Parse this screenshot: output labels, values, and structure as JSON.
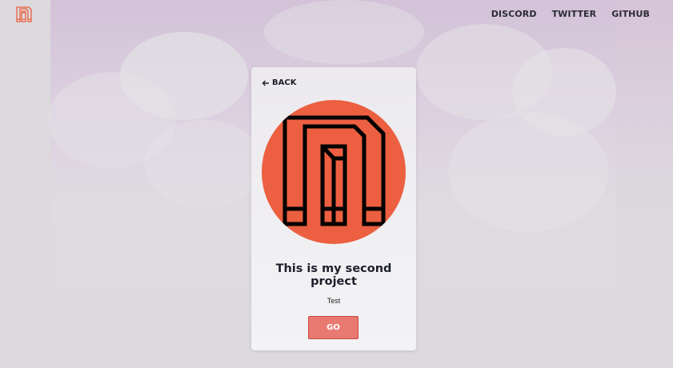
{
  "nav": {
    "links": [
      {
        "label": "DISCORD"
      },
      {
        "label": "TWITTER"
      },
      {
        "label": "GITHUB"
      }
    ]
  },
  "card": {
    "back_label": "BACK",
    "title": "This is my second project",
    "description": "Test",
    "go_label": "GO"
  },
  "colors": {
    "brand_orange": "#ec5f40",
    "button_bg": "#e87a72",
    "button_border": "#c9473f",
    "text_dark": "#1d1f2b"
  },
  "icons": {
    "site_logo": "m-logo-icon",
    "back": "arrow-left-icon",
    "project_logo": "m-logo-icon"
  }
}
